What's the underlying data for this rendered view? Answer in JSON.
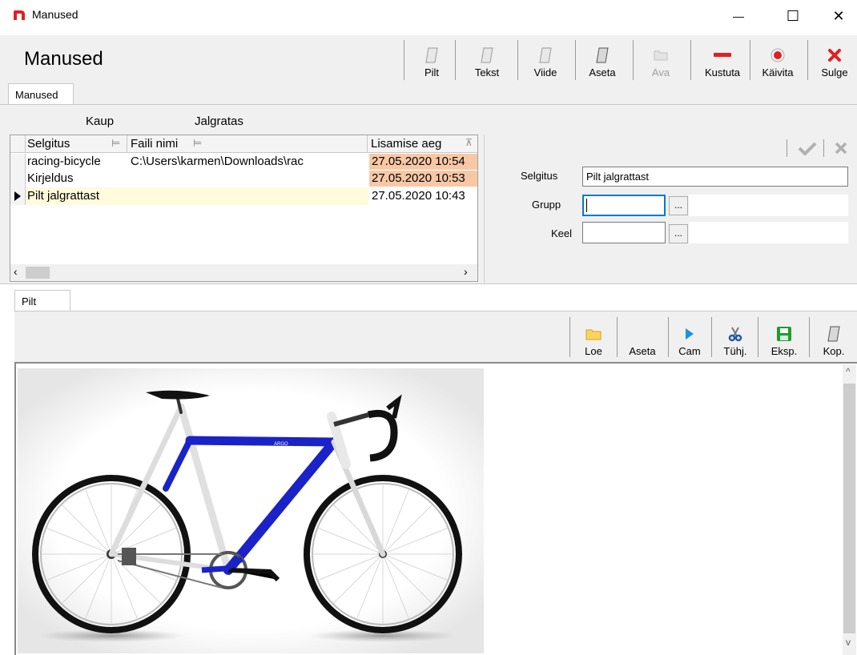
{
  "window": {
    "title": "Manused",
    "minimize": "—",
    "maximize": "☐",
    "close": "✕"
  },
  "header": {
    "title": "Manused"
  },
  "toolbar": [
    {
      "label": "Pilt",
      "icon": "page-icon",
      "disabled": false
    },
    {
      "label": "Tekst",
      "icon": "page-icon",
      "disabled": false
    },
    {
      "label": "Viide",
      "icon": "page-icon",
      "disabled": false
    },
    {
      "label": "Aseta",
      "icon": "paste-icon",
      "disabled": false
    },
    {
      "label": "Ava",
      "icon": "folder-icon",
      "disabled": true
    },
    {
      "label": "Kustuta",
      "icon": "minus-icon",
      "disabled": false
    },
    {
      "label": "Käivita",
      "icon": "record-icon",
      "disabled": false
    },
    {
      "label": "Sulge",
      "icon": "close-icon",
      "disabled": false
    }
  ],
  "top_tab": "Manused",
  "context": {
    "label": "Kaup",
    "value": "Jalgratas"
  },
  "grid": {
    "columns": [
      "Selgitus",
      "Faili nimi",
      "Lisamise aeg"
    ],
    "rows": [
      {
        "selgitus": "racing-bicycle",
        "faili_nimi": "C:\\Users\\karmen\\Downloads\\rac",
        "aeg": "27.05.2020 10:54",
        "current": false
      },
      {
        "selgitus": "Kirjeldus",
        "faili_nimi": "",
        "aeg": "27.05.2020 10:53",
        "current": false
      },
      {
        "selgitus": "Pilt jalgrattast",
        "faili_nimi": "",
        "aeg": "27.05.2020 10:43",
        "current": true
      }
    ]
  },
  "form": {
    "selgitus_label": "Selgitus",
    "selgitus_value": "Pilt jalgrattast",
    "grupp_label": "Grupp",
    "grupp_value": "",
    "keel_label": "Keel",
    "keel_value": "",
    "browse": "..."
  },
  "bottom_tab": "Pilt",
  "image_toolbar": [
    {
      "label": "Loe",
      "icon": "folder-icon"
    },
    {
      "label": "Aseta",
      "icon": "none"
    },
    {
      "label": "Cam",
      "icon": "play-icon"
    },
    {
      "label": "Tühj.",
      "icon": "scissors-icon"
    },
    {
      "label": "Eksp.",
      "icon": "save-icon"
    },
    {
      "label": "Kop.",
      "icon": "page-icon"
    }
  ],
  "frame_text": "ARGO",
  "colors": {
    "accent_red": "#e31e24",
    "orange_cell": "#f8c8a6",
    "current_row": "#fffbdc",
    "frame_blue": "#1a22c8"
  }
}
